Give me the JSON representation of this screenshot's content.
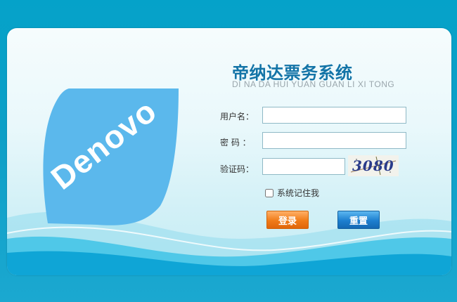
{
  "app": {
    "title": "帝纳达票务系统",
    "subtitle": "DI NA DA HUI YUAN GUAN LI XI TONG",
    "logo_text": "Denovo"
  },
  "form": {
    "username_label": "用户名：",
    "username_value": "",
    "password_label": "密  码 ：",
    "password_value": "",
    "captcha_label": "验证码：",
    "captcha_value": "",
    "captcha_text": "3080",
    "remember_label": "系统记住我",
    "remember_checked": false
  },
  "buttons": {
    "login": "登录",
    "reset": "重置"
  },
  "colors": {
    "background": "#05a2c9",
    "title": "#1374a7",
    "logo": "#5bb8ec",
    "login_button": "#f07b18",
    "reset_button": "#1d7fcf"
  }
}
